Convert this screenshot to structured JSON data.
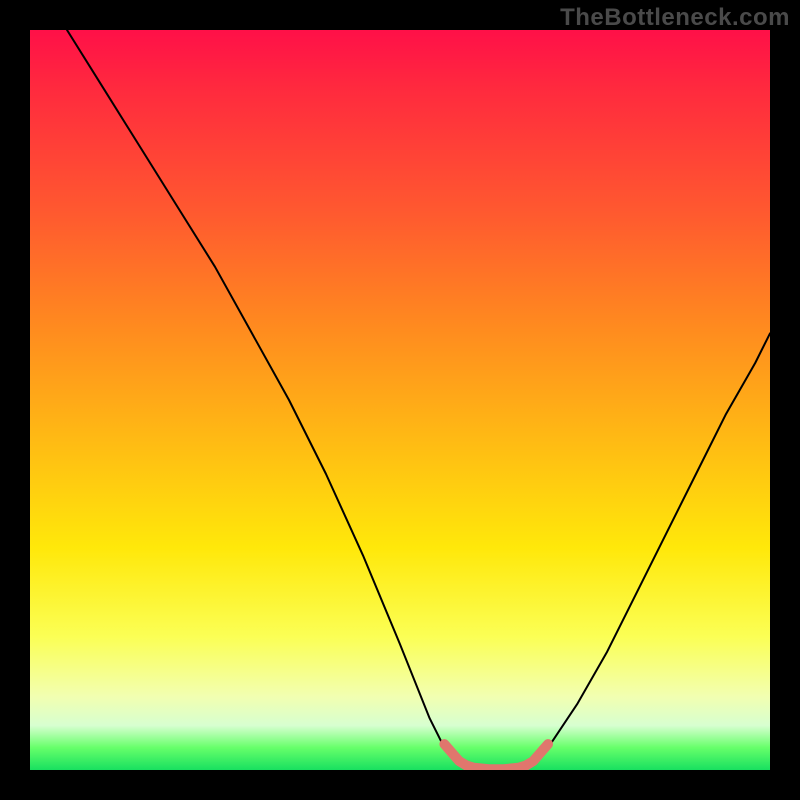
{
  "watermark": "TheBottleneck.com",
  "chart_data": {
    "type": "line",
    "title": "",
    "xlabel": "",
    "ylabel": "",
    "xlim": [
      0,
      100
    ],
    "ylim": [
      0,
      100
    ],
    "gradient_stops": [
      {
        "pos": 0,
        "color": "#ff1048"
      },
      {
        "pos": 8,
        "color": "#ff2a3e"
      },
      {
        "pos": 25,
        "color": "#ff5a2f"
      },
      {
        "pos": 40,
        "color": "#ff8a1f"
      },
      {
        "pos": 55,
        "color": "#ffb914"
      },
      {
        "pos": 70,
        "color": "#ffe80a"
      },
      {
        "pos": 82,
        "color": "#fbff55"
      },
      {
        "pos": 90,
        "color": "#f2ffb0"
      },
      {
        "pos": 94,
        "color": "#d7ffd0"
      },
      {
        "pos": 97,
        "color": "#66ff6a"
      },
      {
        "pos": 100,
        "color": "#18e060"
      }
    ],
    "series": [
      {
        "name": "left-curve",
        "color": "#000000",
        "width": 2,
        "x": [
          5,
          10,
          15,
          20,
          25,
          30,
          35,
          40,
          45,
          50,
          54,
          56,
          58
        ],
        "y": [
          100,
          92,
          84,
          76,
          68,
          59,
          50,
          40,
          29,
          17,
          7,
          3,
          1
        ]
      },
      {
        "name": "right-curve",
        "color": "#000000",
        "width": 2,
        "x": [
          68,
          70,
          74,
          78,
          82,
          86,
          90,
          94,
          98,
          100
        ],
        "y": [
          1,
          3,
          9,
          16,
          24,
          32,
          40,
          48,
          55,
          59
        ]
      },
      {
        "name": "valley-highlight",
        "color": "#e0766d",
        "width": 10,
        "x": [
          56,
          58,
          59,
          60,
          62,
          64,
          66,
          67,
          68,
          70
        ],
        "y": [
          3.5,
          1.2,
          0.6,
          0.3,
          0.1,
          0.1,
          0.3,
          0.6,
          1.2,
          3.5
        ]
      }
    ]
  }
}
